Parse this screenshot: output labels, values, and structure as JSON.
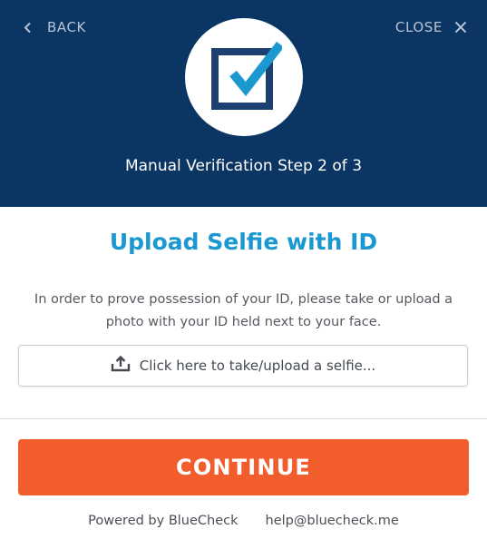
{
  "header": {
    "back_label": "BACK",
    "close_label": "CLOSE",
    "step_text": "Manual Verification Step 2 of 3",
    "logo_icon": "bluecheck-checkbox-logo",
    "background_color": "#0b3563"
  },
  "main": {
    "title": "Upload Selfie with ID",
    "description": "In order to prove possession of your ID, please take or upload a photo with your ID held next to your face.",
    "upload_label": "Click here to take/upload a selfie...",
    "upload_icon": "upload-icon",
    "title_color": "#1a98cf"
  },
  "actions": {
    "continue_label": "CONTINUE",
    "continue_color": "#f15d2c"
  },
  "footer": {
    "powered_by": "Powered by BlueCheck",
    "help_email": "help@bluecheck.me"
  }
}
